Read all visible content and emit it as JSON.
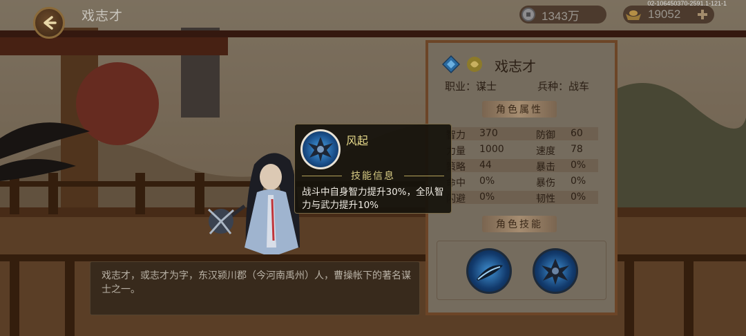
{
  "header": {
    "title": "戏志才",
    "silver": "1343万",
    "gold": "19052",
    "build_info": "02-106450370-2591.1-121-1"
  },
  "panel": {
    "hero_name": "戏志才",
    "class_label": "职业：谋士",
    "troop_label": "兵种：战车",
    "attr_header": "角色属性",
    "skill_header": "角色技能",
    "stats": [
      {
        "l_name": "智力",
        "l_val": "370",
        "r_name": "防御",
        "r_val": "60"
      },
      {
        "l_name": "力量",
        "l_val": "1000",
        "r_name": "速度",
        "r_val": "78"
      },
      {
        "l_name": "策略",
        "l_val": "44",
        "r_name": "暴击",
        "r_val": "0%"
      },
      {
        "l_name": "命中",
        "l_val": "0%",
        "r_name": "暴伤",
        "r_val": "0%"
      },
      {
        "l_name": "闪避",
        "l_val": "0%",
        "r_name": "韧性",
        "r_val": "0%"
      }
    ]
  },
  "tooltip": {
    "skill_name": "风起",
    "sub_title": "技能信息",
    "description": "战斗中自身智力提升30%，全队智力与武力提升10%"
  },
  "description": "戏志才，或志才为字，东汉颍川郡（今河南禹州）人，曹操帐下的著名谋士之一。",
  "icons": [
    "back-arrow-icon",
    "silver-coin-icon",
    "gold-ingot-icon",
    "add-icon",
    "grade-badge-icon",
    "strategist-class-icon",
    "feather-skill-icon",
    "wind-skill-icon"
  ],
  "colors": {
    "panel_border": "#6c4527",
    "tooltip_title": "#e6d98a",
    "accent_gold": "#c8a040"
  }
}
